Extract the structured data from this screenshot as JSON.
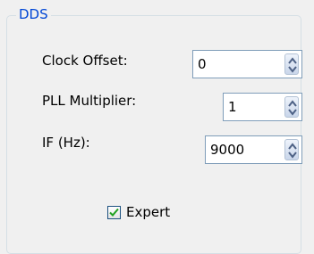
{
  "group": {
    "title": "DDS"
  },
  "fields": [
    {
      "label": "Clock Offset:",
      "value": "0"
    },
    {
      "label": "PLL Multiplier:",
      "value": "1"
    },
    {
      "label": "IF (Hz):",
      "value": "9000"
    }
  ],
  "expert": {
    "label": "Expert",
    "checked": true
  },
  "colors": {
    "title": "#0046d5",
    "check": "#21a121",
    "border": "#7f9db9"
  },
  "icons": {
    "spinner": "spin-updown-icon",
    "check": "checkmark-icon"
  }
}
